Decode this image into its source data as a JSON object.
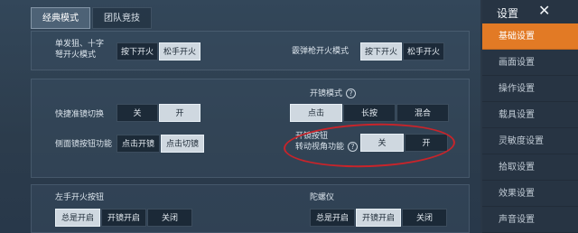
{
  "tabs": [
    {
      "label": "经典模式"
    },
    {
      "label": "团队竞技"
    }
  ],
  "panel1": {
    "row1": {
      "label": "单发狙、十字\n弩开火模式",
      "options": [
        "按下开火",
        "松手开火"
      ]
    },
    "row2": {
      "label": "霰弹枪开火模式",
      "options": [
        "按下开火",
        "松手开火"
      ]
    }
  },
  "panel2": {
    "scope_mode": {
      "label": "开镜模式",
      "options": [
        "点击",
        "长按",
        "混合"
      ]
    },
    "quick_scope": {
      "label": "快捷准镜切换",
      "options": [
        "关",
        "开"
      ]
    },
    "side_scope": {
      "label": "侧面镜按钮功能",
      "options": [
        "点击开镜",
        "点击切镜"
      ]
    },
    "scope_rotate": {
      "label": "开镜按钮\n转动视角功能",
      "options": [
        "关",
        "开"
      ]
    }
  },
  "panel3": {
    "left_fire": {
      "label": "左手开火按钮",
      "options": [
        "总是开启",
        "开镜开启",
        "关闭"
      ]
    },
    "gyro": {
      "label": "陀螺仪",
      "options": [
        "总是开启",
        "开镜开启",
        "关闭"
      ]
    }
  },
  "sidebar": {
    "title": "设置",
    "close": "✕",
    "items": [
      {
        "label": "基础设置"
      },
      {
        "label": "画面设置"
      },
      {
        "label": "操作设置"
      },
      {
        "label": "载具设置"
      },
      {
        "label": "灵敏度设置"
      },
      {
        "label": "拾取设置"
      },
      {
        "label": "效果设置"
      },
      {
        "label": "声音设置"
      }
    ]
  },
  "icons": {
    "help": "?"
  },
  "colors": {
    "accent": "#e27a25",
    "annotation": "#c8242a"
  }
}
